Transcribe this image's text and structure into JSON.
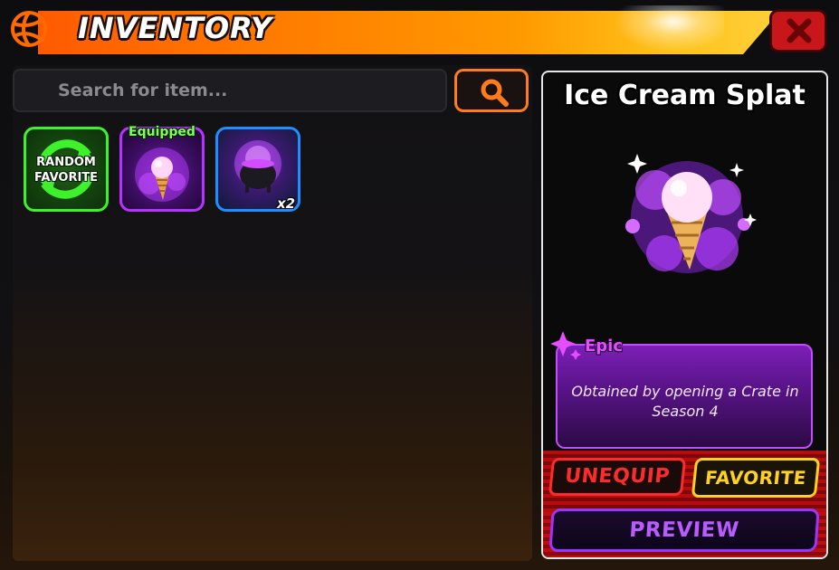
{
  "header": {
    "title": "INVENTORY",
    "logo_icon": "volleyball-icon",
    "close_icon": "close-x-icon",
    "accent_color": "#ff7a00"
  },
  "search": {
    "placeholder": "Search for item...",
    "value": "",
    "button_icon": "search-icon",
    "button_color": "#ff7b1c"
  },
  "inventory": {
    "slots": [
      {
        "label": "RANDOM FAVORITE",
        "icon": "shuffle-arrows-icon",
        "border_color": "#3ef12a"
      },
      {
        "tag": "Equipped",
        "icon": "ice-cream-splat-icon",
        "border_color": "#b533ff"
      },
      {
        "quantity": "x2",
        "icon": "cauldron-icon",
        "border_color": "#1e8fff"
      }
    ]
  },
  "detail": {
    "title": "Ice Cream Splat",
    "rarity": "Epic",
    "rarity_color": "#e54dff",
    "description": "Obtained by opening a Crate in Season 4",
    "art_icon": "ice-cream-splat-icon",
    "buttons": {
      "unequip": "UNEQUIP",
      "favorite": "FAVORITE",
      "preview": "PREVIEW"
    }
  }
}
